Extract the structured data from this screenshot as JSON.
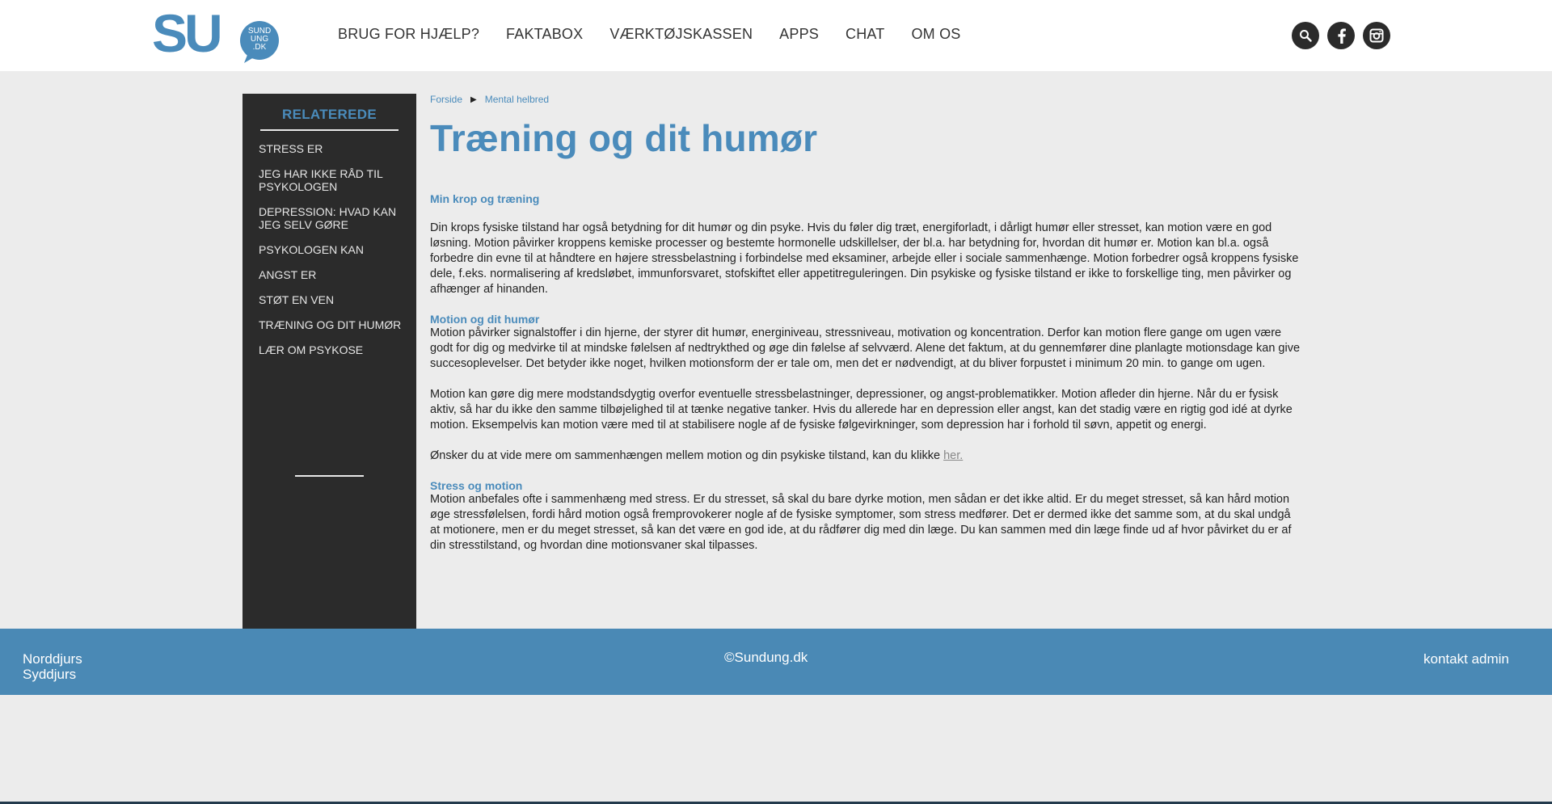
{
  "header": {
    "logo_text": "SU",
    "logo_sub": [
      "SUND",
      "UNG",
      ".DK"
    ],
    "nav": [
      "BRUG FOR HJÆLP?",
      "FAKTABOX",
      "VÆRKTØJSKASSEN",
      "APPS",
      "CHAT",
      "OM OS"
    ],
    "icons": [
      "search-icon",
      "facebook-icon",
      "instagram-icon"
    ]
  },
  "sidebar": {
    "title": "RELATEREDE",
    "items": [
      "STRESS ER",
      "JEG HAR IKKE RÅD TIL PSYKOLOGEN",
      "DEPRESSION: HVAD KAN JEG SELV GØRE",
      "PSYKOLOGEN KAN",
      "ANGST ER",
      "STØT EN VEN",
      "TRÆNING OG DIT HUMØR",
      "LÆR OM PSYKOSE"
    ]
  },
  "breadcrumb": {
    "home": "Forside",
    "separator": "▶",
    "current": "Mental helbred"
  },
  "article": {
    "title": "Træning og dit humør",
    "s1_title": "Min krop og træning",
    "s1_text": "Din krops fysiske tilstand har også betydning for dit humør og din psyke. Hvis du føler dig træt, energiforladt, i dårligt humør eller stresset, kan motion være en god løsning. Motion påvirker kroppens kemiske processer og bestemte hormonelle udskillelser, der bl.a. har betydning for, hvordan dit humør er. Motion kan bl.a. også forbedre din evne til at håndtere en højere stressbelastning i forbindelse med eksaminer, arbejde eller i sociale sammenhænge. Motion forbedrer også kroppens fysiske dele, f.eks. normalisering af kredsløbet, immunforsvaret, stofskiftet eller appetitreguleringen. Din psykiske og fysiske tilstand er ikke to forskellige ting, men påvirker og afhænger af hinanden.",
    "s2_title": "Motion og dit humør",
    "s2_text": "Motion påvirker signalstoffer i din hjerne, der styrer dit humør, energiniveau, stressniveau, motivation og koncentration. Derfor kan motion flere gange om ugen være godt for dig og medvirke til at mindske følelsen af nedtrykthed og øge din følelse af selvværd. Alene det faktum, at du gennemfører dine planlagte motionsdage kan give succesoplevelser. Det betyder ikke noget, hvilken motionsform der er tale om, men det er nødvendigt, at du bliver forpustet i minimum 20 min. to gange om ugen.",
    "s2_text2": "Motion kan gøre dig mere modstandsdygtig overfor eventuelle stressbelastninger, depressioner, og angst-problematikker. Motion afleder din hjerne. Når du er fysisk aktiv, så har du ikke den samme tilbøjelighed til at tænke negative tanker. Hvis du allerede har en depression eller angst, kan det stadig være en rigtig god idé at dyrke motion. Eksempelvis kan motion være med til at stabilisere nogle af de fysiske følgevirkninger, som depression har i forhold til søvn, appetit og energi.",
    "more_text": "Ønsker du at vide mere om sammenhængen mellem motion og din psykiske tilstand, kan du klikke ",
    "more_link": "her.",
    "s3_title": "Stress og motion",
    "s3_text": "Motion anbefales ofte i sammenhæng med stress. Er du stresset, så skal du bare dyrke motion, men sådan er det ikke altid. Er du meget stresset, så kan hård motion øge stressfølelsen, fordi hård motion også fremprovokerer nogle af de fysiske symptomer, som stress medfører. Det er dermed ikke det samme som, at du skal undgå at motionere, men er du meget stresset, så kan det være en god ide, at du rådfører dig med din læge. Du kan sammen med din læge finde ud af hvor påvirket du er af din stresstilstand, og hvordan dine motionsvaner skal tilpasses."
  },
  "footer": {
    "region1": "Norddjurs",
    "region2": "Syddjurs",
    "copyright": "©Sundung.dk",
    "contact": "kontakt admin"
  },
  "colors": {
    "accent": "#4a8bbb",
    "sidebar_bg": "#2b2b2b",
    "page_bg": "#ececec",
    "footer_bg": "#4a89b5"
  }
}
